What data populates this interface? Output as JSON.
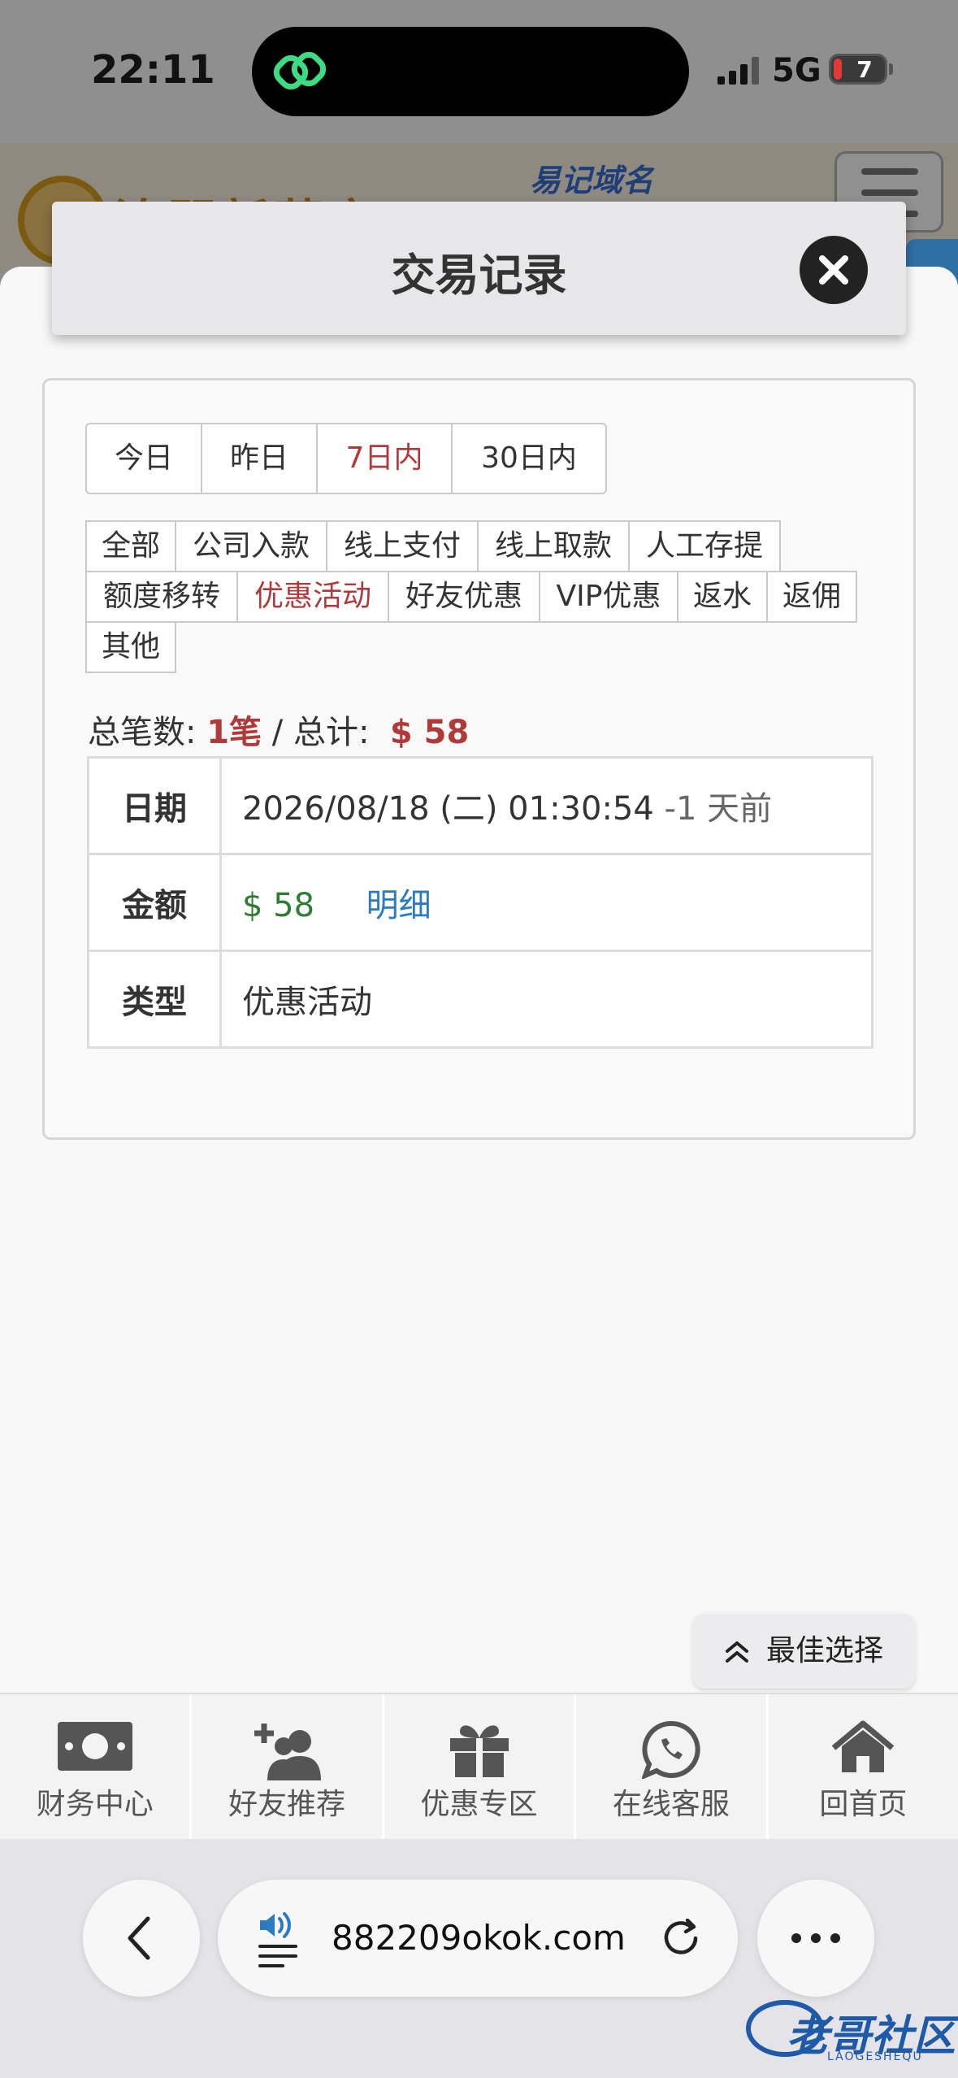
{
  "status_bar": {
    "time": "22:11",
    "network": "5G",
    "battery": "7"
  },
  "site": {
    "logo_text": "澳門新葡京",
    "header_link": "易记域名"
  },
  "modal": {
    "title": "交易记录",
    "date_tabs": [
      {
        "label": "今日",
        "active": false
      },
      {
        "label": "昨日",
        "active": false
      },
      {
        "label": "7日内",
        "active": true
      },
      {
        "label": "30日内",
        "active": false
      }
    ],
    "categories": [
      {
        "label": "全部",
        "active": false
      },
      {
        "label": "公司入款",
        "active": false
      },
      {
        "label": "线上支付",
        "active": false
      },
      {
        "label": "线上取款",
        "active": false
      },
      {
        "label": "人工存提",
        "active": false
      },
      {
        "label": "额度移转",
        "active": false
      },
      {
        "label": "优惠活动",
        "active": true
      },
      {
        "label": "好友优惠",
        "active": false
      },
      {
        "label": "VIP优惠",
        "active": false
      },
      {
        "label": "返水",
        "active": false
      },
      {
        "label": "返佣",
        "active": false
      },
      {
        "label": "其他",
        "active": false
      }
    ],
    "summary": {
      "count_label": "总笔数:",
      "count_value": "1笔",
      "separator": " / ",
      "total_label": "总计:",
      "total_value": "$ 58"
    },
    "record": {
      "date_header": "日期",
      "date_value": "2026/08/18 (二) 01:30:54",
      "date_relative": " -1 天前",
      "amount_header": "金额",
      "amount_value": "$ 58",
      "detail_link": "明细",
      "type_header": "类型",
      "type_value": "优惠活动"
    }
  },
  "best_choice": "最佳选择",
  "bottom_nav": [
    {
      "label": "财务中心",
      "icon": "money-icon"
    },
    {
      "label": "好友推荐",
      "icon": "add-friend-icon"
    },
    {
      "label": "优惠专区",
      "icon": "gift-icon"
    },
    {
      "label": "在线客服",
      "icon": "whatsapp-icon"
    },
    {
      "label": "回首页",
      "icon": "home-icon"
    }
  ],
  "browser": {
    "url": "882209okok.com"
  },
  "watermark": {
    "text": "老哥社区",
    "sub": "LAOGESHEQU"
  },
  "colors": {
    "active_red": "#b03a3a",
    "amount_green": "#2e7d32",
    "link_blue": "#2b7bc1"
  }
}
